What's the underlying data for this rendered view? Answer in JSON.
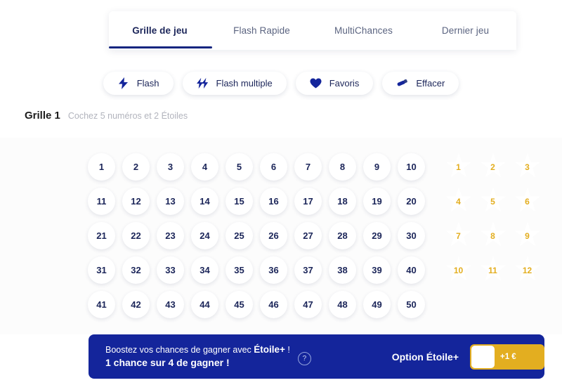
{
  "tabs": [
    {
      "label": "Grille de jeu",
      "active": true
    },
    {
      "label": "Flash Rapide",
      "active": false
    },
    {
      "label": "MultiChances",
      "active": false
    },
    {
      "label": "Dernier jeu",
      "active": false
    }
  ],
  "actions": [
    {
      "label": "Flash",
      "icon": "lightning-icon"
    },
    {
      "label": "Flash multiple",
      "icon": "double-lightning-icon"
    },
    {
      "label": "Favoris",
      "icon": "heart-icon"
    },
    {
      "label": "Effacer",
      "icon": "eraser-icon"
    }
  ],
  "grid_header": {
    "title": "Grille 1",
    "instruction": "Cochez 5 numéros et 2 Étoiles"
  },
  "numbers": [
    "1",
    "2",
    "3",
    "4",
    "5",
    "6",
    "7",
    "8",
    "9",
    "10",
    "11",
    "12",
    "13",
    "14",
    "15",
    "16",
    "17",
    "18",
    "19",
    "20",
    "21",
    "22",
    "23",
    "24",
    "25",
    "26",
    "27",
    "28",
    "29",
    "30",
    "31",
    "32",
    "33",
    "34",
    "35",
    "36",
    "37",
    "38",
    "39",
    "40",
    "41",
    "42",
    "43",
    "44",
    "45",
    "46",
    "47",
    "48",
    "49",
    "50"
  ],
  "stars": [
    "1",
    "2",
    "3",
    "4",
    "5",
    "6",
    "7",
    "8",
    "9",
    "10",
    "11",
    "12"
  ],
  "banner": {
    "line1_prefix": "Boostez vos chances de gagner avec ",
    "line1_bold": "Étoile+",
    "line1_suffix": " !",
    "line2": "1 chance sur 4 de gagner !",
    "help_glyph": "?",
    "option_label": "Option Étoile+",
    "toggle_price": "+1 €"
  },
  "colors": {
    "navy": "#14259b",
    "gold": "#e3ae20",
    "text_navy": "#1b2559",
    "muted": "#5b6480",
    "page_bg": "#fcfcfc"
  }
}
